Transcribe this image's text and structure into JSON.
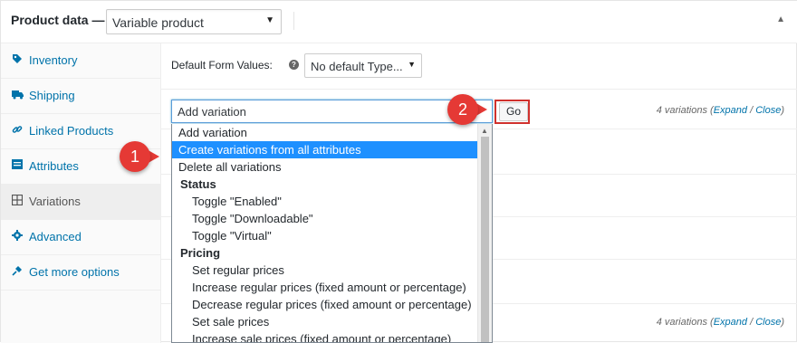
{
  "header": {
    "title": "Product data —",
    "product_type": "Variable product"
  },
  "sidebar": {
    "items": [
      {
        "label": "Inventory",
        "icon": "tag-icon"
      },
      {
        "label": "Shipping",
        "icon": "truck-icon"
      },
      {
        "label": "Linked Products",
        "icon": "link-icon"
      },
      {
        "label": "Attributes",
        "icon": "list-icon"
      },
      {
        "label": "Variations",
        "icon": "grid-icon"
      },
      {
        "label": "Advanced",
        "icon": "gear-icon"
      },
      {
        "label": "Get more options",
        "icon": "plugin-icon"
      }
    ]
  },
  "main": {
    "default_form_values_label": "Default Form Values:",
    "help_glyph": "?",
    "default_form_values_value": "No default Type...",
    "bulk_select_value": "Add variation",
    "go_label": "Go",
    "variations_count": "4 variations",
    "expand_label": "Expand",
    "slash": " / ",
    "close_label": "Close"
  },
  "dropdown": {
    "items": [
      {
        "label": "Add variation",
        "kind": "option"
      },
      {
        "label": "Create variations from all attributes",
        "kind": "option",
        "selected": true
      },
      {
        "label": "Delete all variations",
        "kind": "option"
      },
      {
        "label": "Status",
        "kind": "group"
      },
      {
        "label": "Toggle \"Enabled\"",
        "kind": "sub"
      },
      {
        "label": "Toggle \"Downloadable\"",
        "kind": "sub"
      },
      {
        "label": "Toggle \"Virtual\"",
        "kind": "sub"
      },
      {
        "label": "Pricing",
        "kind": "group"
      },
      {
        "label": "Set regular prices",
        "kind": "sub"
      },
      {
        "label": "Increase regular prices (fixed amount or percentage)",
        "kind": "sub"
      },
      {
        "label": "Decrease regular prices (fixed amount or percentage)",
        "kind": "sub"
      },
      {
        "label": "Set sale prices",
        "kind": "sub"
      },
      {
        "label": "Increase sale prices (fixed amount or percentage)",
        "kind": "sub"
      }
    ]
  },
  "callouts": {
    "one": "1",
    "two": "2"
  },
  "colors": {
    "link": "#0073aa",
    "selected": "#1e90ff",
    "callout": "#e53935",
    "highlight_border": "#d0312d"
  }
}
